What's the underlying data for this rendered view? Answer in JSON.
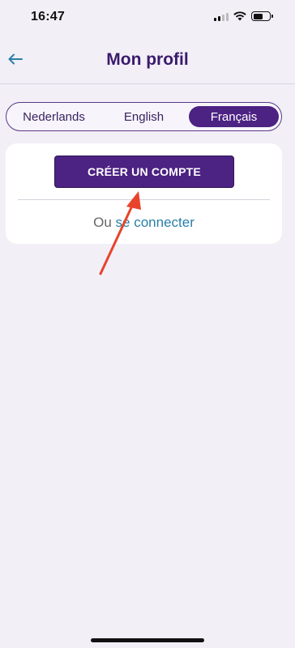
{
  "status_bar": {
    "time": "16:47",
    "icons": [
      "cellular-signal-icon",
      "wifi-icon",
      "battery-icon"
    ]
  },
  "header": {
    "title": "Mon profil",
    "back_icon": "arrow-left-icon"
  },
  "language_switch": {
    "options": [
      "Nederlands",
      "English",
      "Français"
    ],
    "selected": "Français"
  },
  "card": {
    "create_account_label": "CRÉER UN COMPTE",
    "login_prefix": "Ou ",
    "login_link": "se connecter"
  },
  "colors": {
    "background": "#f2eff7",
    "primary": "#4c2283",
    "link": "#2a7fa8",
    "annotation": "#e8432b"
  }
}
